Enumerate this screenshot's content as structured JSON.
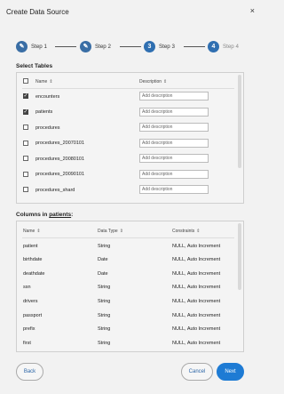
{
  "dialog": {
    "title": "Create Data Source",
    "close": "×"
  },
  "stepper": {
    "steps": [
      {
        "label": "Step 1",
        "glyph": "✎",
        "state": "done"
      },
      {
        "label": "Step 2",
        "glyph": "✎",
        "state": "done"
      },
      {
        "label": "Step 3",
        "glyph": "3",
        "state": "active"
      },
      {
        "label": "Step 4",
        "glyph": "4",
        "state": "upcoming"
      }
    ]
  },
  "tables": {
    "section_label": "Select Tables",
    "header": {
      "name": "Name",
      "description": "Description",
      "sort": "⇕"
    },
    "placeholder": "Add description",
    "rows": [
      {
        "name": "encounters",
        "checked": true
      },
      {
        "name": "patients",
        "checked": true
      },
      {
        "name": "procedures",
        "checked": false
      },
      {
        "name": "procedures_20070101",
        "checked": false
      },
      {
        "name": "procedures_20080101",
        "checked": false
      },
      {
        "name": "procedures_20090101",
        "checked": false
      },
      {
        "name": "procedures_shard",
        "checked": false
      }
    ]
  },
  "columns": {
    "section_label_prefix": "Columns in ",
    "section_table": "patients",
    "section_label_suffix": ":",
    "header": {
      "name": "Name",
      "type": "Data Type",
      "constraints": "Constraints",
      "sort": "⇕"
    },
    "rows": [
      {
        "name": "patient",
        "type": "String",
        "constraints": "NULL, Auto Increment"
      },
      {
        "name": "birthdate",
        "type": "Date",
        "constraints": "NULL, Auto Increment"
      },
      {
        "name": "deathdate",
        "type": "Date",
        "constraints": "NULL, Auto Increment"
      },
      {
        "name": "ssn",
        "type": "String",
        "constraints": "NULL, Auto Increment"
      },
      {
        "name": "drivers",
        "type": "String",
        "constraints": "NULL, Auto Increment"
      },
      {
        "name": "passport",
        "type": "String",
        "constraints": "NULL, Auto Increment"
      },
      {
        "name": "prefix",
        "type": "String",
        "constraints": "NULL, Auto Increment"
      },
      {
        "name": "first",
        "type": "String",
        "constraints": "NULL, Auto Increment"
      }
    ]
  },
  "footer": {
    "back": "Back",
    "cancel": "Cancel",
    "next": "Next"
  },
  "colors": {
    "accent": "#1e7bd4",
    "step": "#3a6ea5",
    "background": "#f2f2f2"
  }
}
